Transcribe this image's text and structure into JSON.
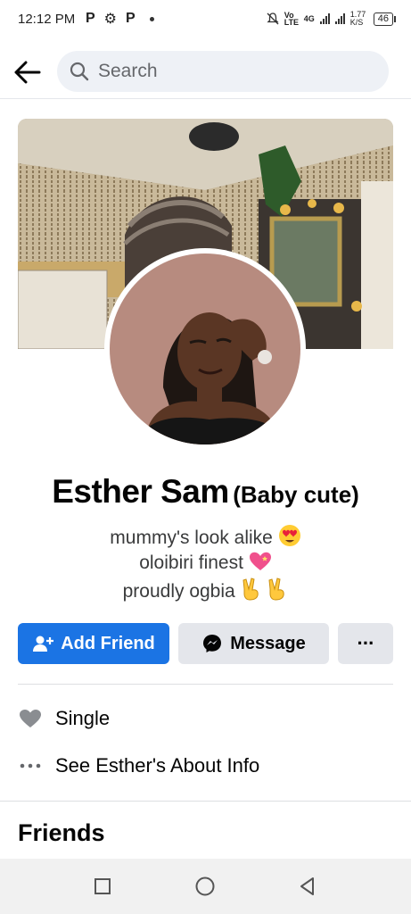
{
  "status_bar": {
    "time": "12:12 PM",
    "left_icons": [
      "P",
      "⚙",
      "P"
    ],
    "network": "4G",
    "volte": "Vo LTE",
    "speed": "1.77 K/S",
    "battery": "46"
  },
  "search": {
    "placeholder": "Search"
  },
  "profile": {
    "name": "Esther Sam",
    "nickname": "(Baby cute)",
    "bio": [
      "mummy's look alike",
      "oloibiri finest",
      "proudly ogbia"
    ]
  },
  "actions": {
    "add_friend": "Add Friend",
    "message": "Message",
    "more": "···"
  },
  "details": [
    {
      "icon": "heart-icon",
      "label": "Single"
    },
    {
      "icon": "more-dots-icon",
      "label": "See Esther's About Info"
    }
  ],
  "friends": {
    "title": "Friends"
  },
  "colors": {
    "primary": "#1b74e4",
    "secondary_btn": "#e4e6eb",
    "text": "#050505"
  }
}
